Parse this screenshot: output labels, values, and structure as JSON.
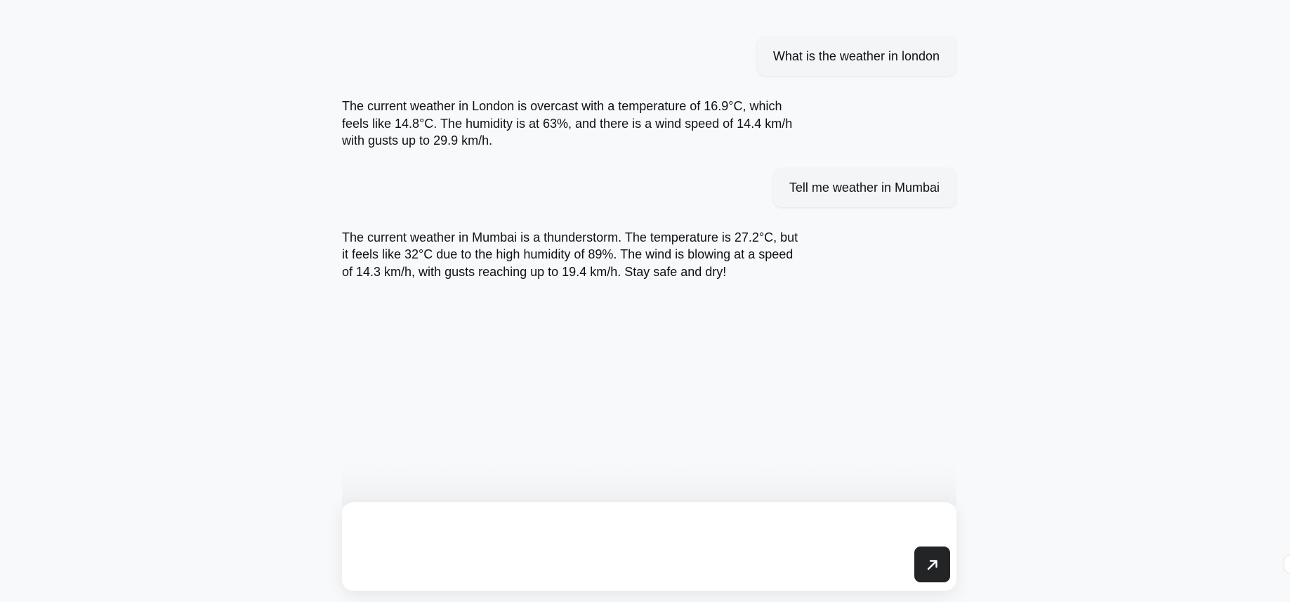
{
  "conversation": {
    "messages": [
      {
        "role": "user",
        "text": "What is the weather in london"
      },
      {
        "role": "assistant",
        "text": "The current weather in London is overcast with a temperature of 16.9°C, which feels like 14.8°C. The humidity is at 63%, and there is a wind speed of 14.4 km/h with gusts up to 29.9 km/h."
      },
      {
        "role": "user",
        "text": "Tell me weather in Mumbai"
      },
      {
        "role": "assistant",
        "text": "The current weather in Mumbai is a thunderstorm. The temperature is 27.2°C, but it feels like 32°C due to the high humidity of 89%. The wind is blowing at a speed of 14.3 km/h, with gusts reaching up to 19.4 km/h. Stay safe and dry!"
      }
    ]
  },
  "composer": {
    "input_value": "",
    "send_icon": "arrow-up-right-icon"
  },
  "colors": {
    "background": "#f8f9fa",
    "send_button": "#222426",
    "user_bubble": "#f4f5f6"
  }
}
